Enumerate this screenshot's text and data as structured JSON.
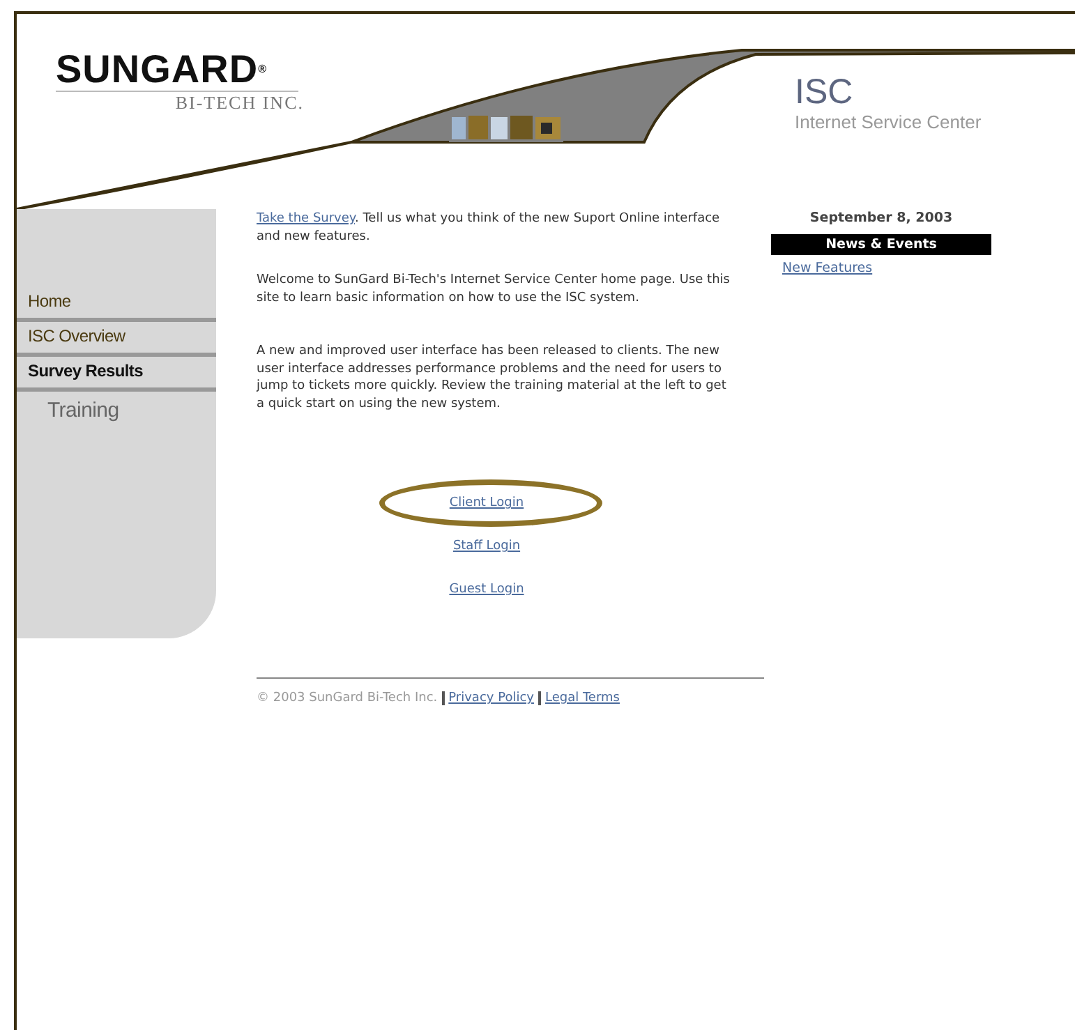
{
  "logo": {
    "name": "SUNGARD",
    "mark": "®",
    "subtitle": "BI-TECH INC."
  },
  "site": {
    "title": "ISC",
    "subtitle": "Internet Service Center"
  },
  "nav": [
    {
      "label": "Home",
      "kind": "link",
      "selected": false
    },
    {
      "label": "ISC Overview",
      "kind": "link",
      "selected": false
    },
    {
      "label": "Survey Results",
      "kind": "link",
      "selected": true
    },
    {
      "label": "Training",
      "kind": "sub",
      "selected": false
    }
  ],
  "intro": {
    "link": "Take the Survey",
    "text": ".  Tell us what you think of the new Suport Online interface and new features."
  },
  "paragraphs": [
    "Welcome to SunGard Bi-Tech's Internet Service Center home page. Use this site to learn basic information on how to use the ISC system.",
    "A new and improved user interface has been released to clients. The new user interface addresses performance problems and the need for users to jump to tickets more quickly. Review the training material at the left to get a quick start on using the new system."
  ],
  "logins": [
    {
      "label": "Client Login",
      "highlighted": true
    },
    {
      "label": "Staff Login",
      "highlighted": false
    },
    {
      "label": "Guest Login",
      "highlighted": false
    }
  ],
  "footer": {
    "copyright": "© 2003 SunGard Bi-Tech Inc.",
    "links": [
      "Privacy Policy",
      "Legal Terms"
    ]
  },
  "sidebar": {
    "date": "September 8, 2003",
    "heading": "News & Events",
    "links": [
      "New Features"
    ]
  }
}
